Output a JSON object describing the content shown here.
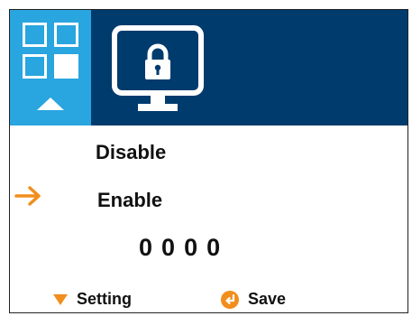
{
  "header": {
    "menu_icon": "menu-grid-icon",
    "up_indicator_icon": "triangle-up-icon",
    "screen_icon": "monitor-lock-icon",
    "colors": {
      "header_bg": "#003B6E",
      "tile_bg": "#29A5DF",
      "accent": "#F18E1C"
    }
  },
  "options": {
    "disable_label": "Disable",
    "enable_label": "Enable",
    "selected": "Enable",
    "selector_icon": "arrow-right-icon"
  },
  "pin": {
    "digits": [
      "0",
      "0",
      "0",
      "0"
    ]
  },
  "footer": {
    "setting_label": "Setting",
    "setting_icon": "triangle-down-icon",
    "save_label": "Save",
    "save_icon": "enter-icon"
  }
}
